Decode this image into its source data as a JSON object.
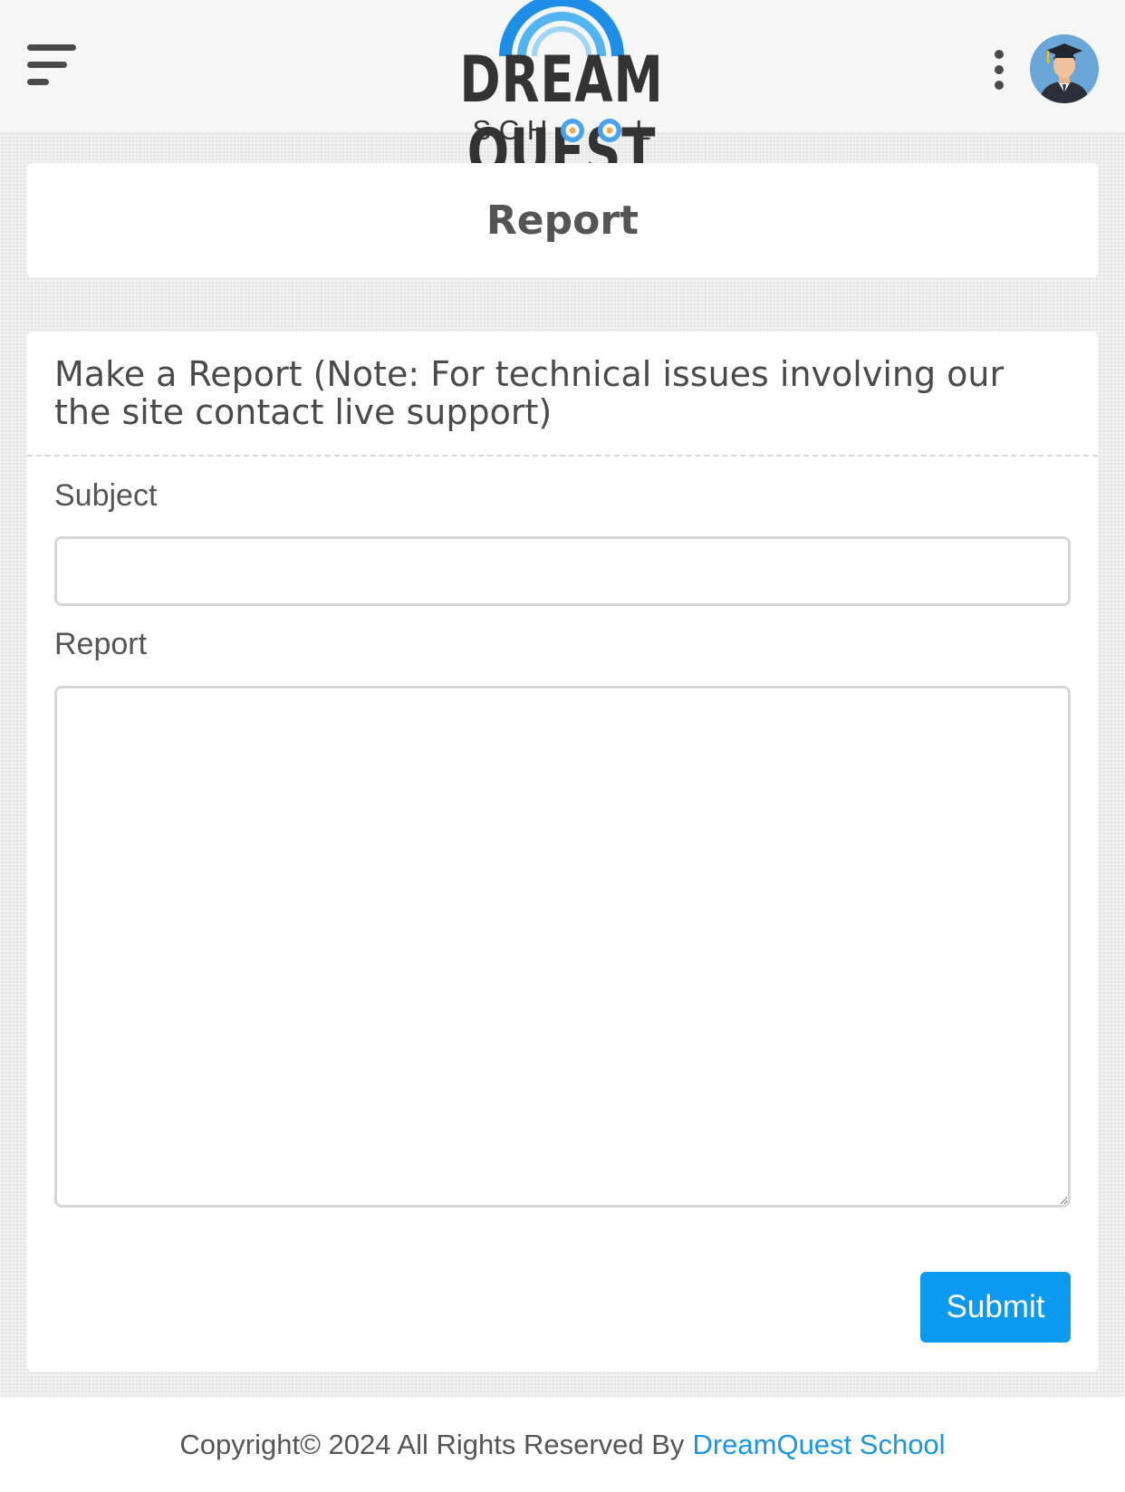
{
  "header": {
    "logo": {
      "title": "DREAM QUEST",
      "subtitle_left": "S C H",
      "subtitle_right": "L"
    },
    "menu_icon": "hamburger-menu-icon",
    "more_icon": "kebab-menu-icon",
    "avatar_icon": "graduate-avatar"
  },
  "page": {
    "title": "Report"
  },
  "form": {
    "heading": "Make a Report (Note: For technical issues involving our the site contact live support)",
    "subject_label": "Subject",
    "subject_value": "",
    "report_label": "Report",
    "report_value": "",
    "submit_label": "Submit"
  },
  "footer": {
    "copyright": "Copyright© 2024 All Rights Reserved By",
    "link_text": "DreamQuest School"
  },
  "colors": {
    "accent": "#0b9af0",
    "link": "#1a95ea",
    "background": "#ececec",
    "text": "#4a4a4a"
  }
}
